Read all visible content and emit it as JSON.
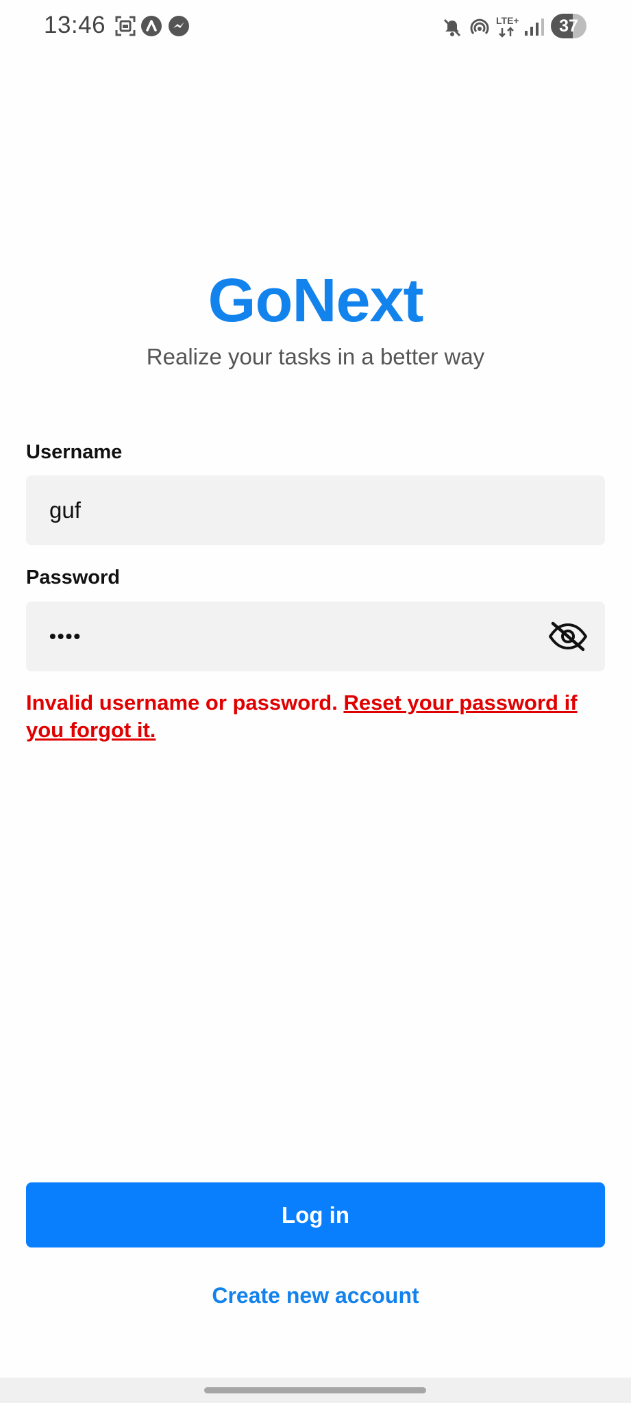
{
  "status_bar": {
    "time": "13:46",
    "network": "LTE+",
    "battery": "37",
    "left_icons": [
      "screenshot-icon",
      "app-icon",
      "messenger-icon"
    ],
    "right_icons": [
      "mute-icon",
      "hotspot-icon",
      "lte-icon",
      "signal-icon",
      "battery-icon"
    ]
  },
  "app": {
    "title": "GoNext",
    "tagline": "Realize your tasks in a better way",
    "accent_color": "#1282ec"
  },
  "form": {
    "username_label": "Username",
    "username_value": "guf",
    "password_label": "Password",
    "password_value": "••••",
    "password_visibility_icon": "eye-off-icon"
  },
  "error": {
    "message": "Invalid username or password.",
    "link": "Reset your password if you forgot it.",
    "color": "#e00000"
  },
  "actions": {
    "login_label": "Log in",
    "login_color": "#0a7ffd",
    "create_account_label": "Create new account"
  }
}
